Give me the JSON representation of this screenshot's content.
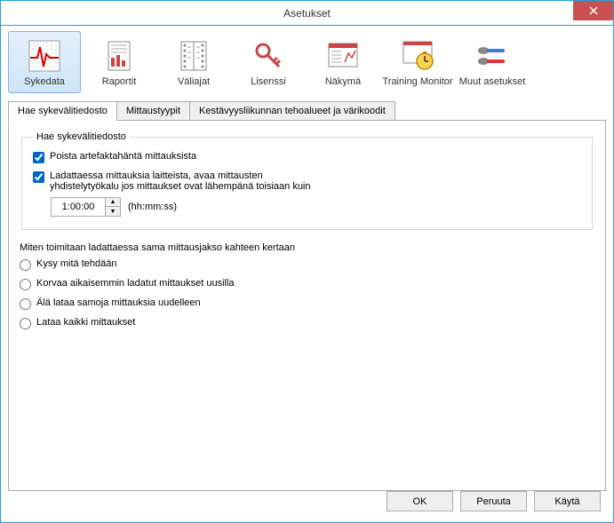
{
  "window": {
    "title": "Asetukset"
  },
  "toolbar": {
    "items": [
      {
        "label": "Sykedata"
      },
      {
        "label": "Raportit"
      },
      {
        "label": "Väliajat"
      },
      {
        "label": "Lisenssi"
      },
      {
        "label": "Näkymä"
      },
      {
        "label": "Training Monitor"
      },
      {
        "label": "Muut asetukset"
      }
    ]
  },
  "subtabs": {
    "items": [
      {
        "label": "Hae sykevälitiedosto"
      },
      {
        "label": "Mittaustyypit"
      },
      {
        "label": "Kestävyysliikunnan tehoalueet ja värikoodit"
      }
    ]
  },
  "group1": {
    "legend": "Hae sykevälitiedosto",
    "cb1": "Poista artefaktahäntä mittauksista",
    "cb2_line1": "Ladattaessa mittauksia laitteista, avaa mittausten",
    "cb2_line2": "yhdistelytyökalu jos mittaukset ovat lähempänä toisiaan kuin",
    "time_value": "1:00:00",
    "time_format": "(hh:mm:ss)"
  },
  "group2": {
    "legend": "Miten toimitaan ladattaessa sama mittausjakso kahteen kertaan",
    "r1": "Kysy mitä tehdään",
    "r2": "Korvaa aikaisemmin ladatut mittaukset uusilla",
    "r3": "Älä lataa samoja mittauksia uudelleen",
    "r4": "Lataa kaikki mittaukset"
  },
  "buttons": {
    "ok": "OK",
    "cancel": "Peruuta",
    "apply": "Käytä"
  }
}
